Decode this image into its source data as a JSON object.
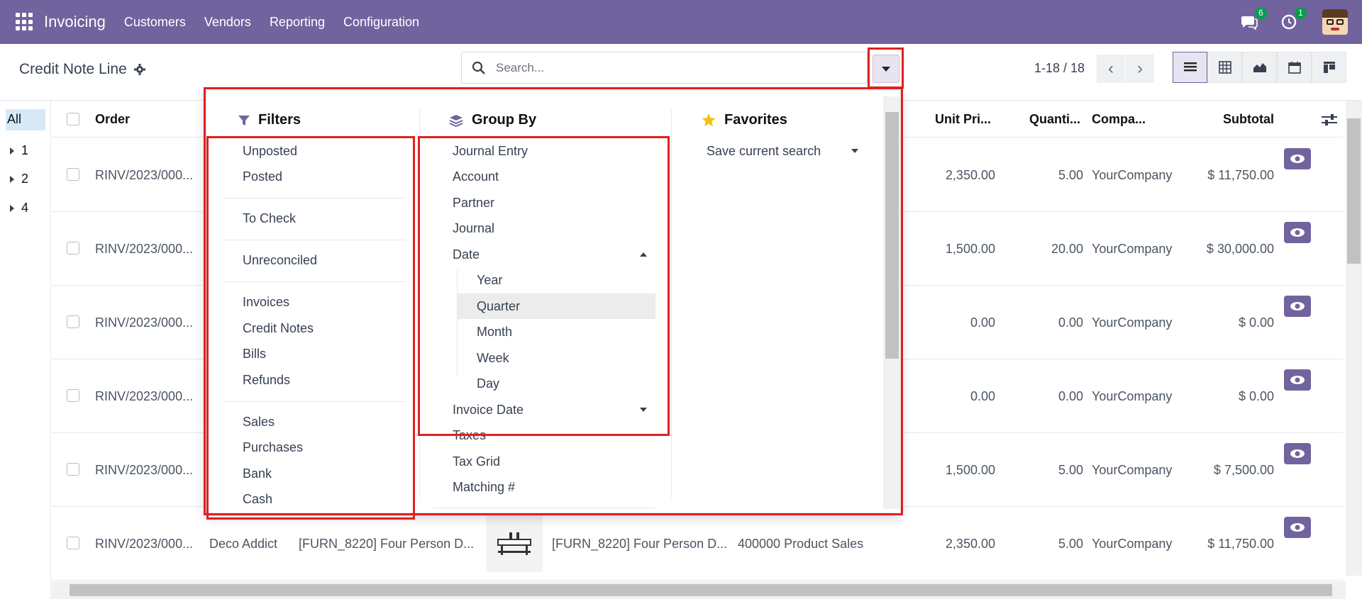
{
  "app": {
    "name": "Invoicing",
    "menu": [
      "Customers",
      "Vendors",
      "Reporting",
      "Configuration"
    ],
    "messages_badge": "6",
    "activity_badge": "1"
  },
  "control_panel": {
    "title": "Credit Note Line",
    "search_placeholder": "Search...",
    "pager": "1-18 / 18",
    "views": [
      "list-view-icon",
      "pivot-view-icon",
      "graph-view-icon",
      "calendar-view-icon",
      "kanban-view-icon"
    ]
  },
  "sidebar": {
    "all_label": "All",
    "groups": [
      "1",
      "2",
      "4"
    ]
  },
  "table": {
    "headers": {
      "order": "Order",
      "unit_price": "Unit Pri...",
      "quantity": "Quanti...",
      "company": "Compa...",
      "subtotal": "Subtotal"
    },
    "rows": [
      {
        "order": "RINV/2023/000...",
        "unit_price": "2,350.00",
        "quantity": "5.00",
        "company": "YourCompany",
        "subtotal": "$ 11,750.00"
      },
      {
        "order": "RINV/2023/000...",
        "unit_price": "1,500.00",
        "quantity": "20.00",
        "company": "YourCompany",
        "subtotal": "$ 30,000.00"
      },
      {
        "order": "RINV/2023/000...",
        "unit_price": "0.00",
        "quantity": "0.00",
        "company": "YourCompany",
        "subtotal": "$ 0.00"
      },
      {
        "order": "RINV/2023/000...",
        "unit_price": "0.00",
        "quantity": "0.00",
        "company": "YourCompany",
        "subtotal": "$ 0.00"
      },
      {
        "order": "RINV/2023/000...",
        "unit_price": "1,500.00",
        "quantity": "5.00",
        "company": "YourCompany",
        "subtotal": "$ 7,500.00"
      },
      {
        "order": "RINV/2023/000...",
        "partner": "Deco Addict",
        "product": "[FURN_8220] Four Person D...",
        "label": "[FURN_8220] Four Person D...",
        "account": "400000 Product Sales",
        "unit_price": "2,350.00",
        "quantity": "5.00",
        "company": "YourCompany",
        "subtotal": "$ 11,750.00"
      }
    ]
  },
  "search_panel": {
    "filters": {
      "title": "Filters",
      "groups": [
        [
          "Unposted",
          "Posted"
        ],
        [
          "To Check"
        ],
        [
          "Unreconciled"
        ],
        [
          "Invoices",
          "Credit Notes",
          "Bills",
          "Refunds"
        ],
        [
          "Sales",
          "Purchases",
          "Bank",
          "Cash"
        ]
      ]
    },
    "group_by": {
      "title": "Group By",
      "items": [
        "Journal Entry",
        "Account",
        "Partner",
        "Journal",
        "Date"
      ],
      "date_options": [
        "Year",
        "Quarter",
        "Month",
        "Week",
        "Day"
      ],
      "selected_date_option": "Quarter",
      "more_items": [
        "Invoice Date",
        "Taxes",
        "Tax Grid",
        "Matching #"
      ]
    },
    "favorites": {
      "title": "Favorites",
      "save_label": "Save current search"
    }
  }
}
